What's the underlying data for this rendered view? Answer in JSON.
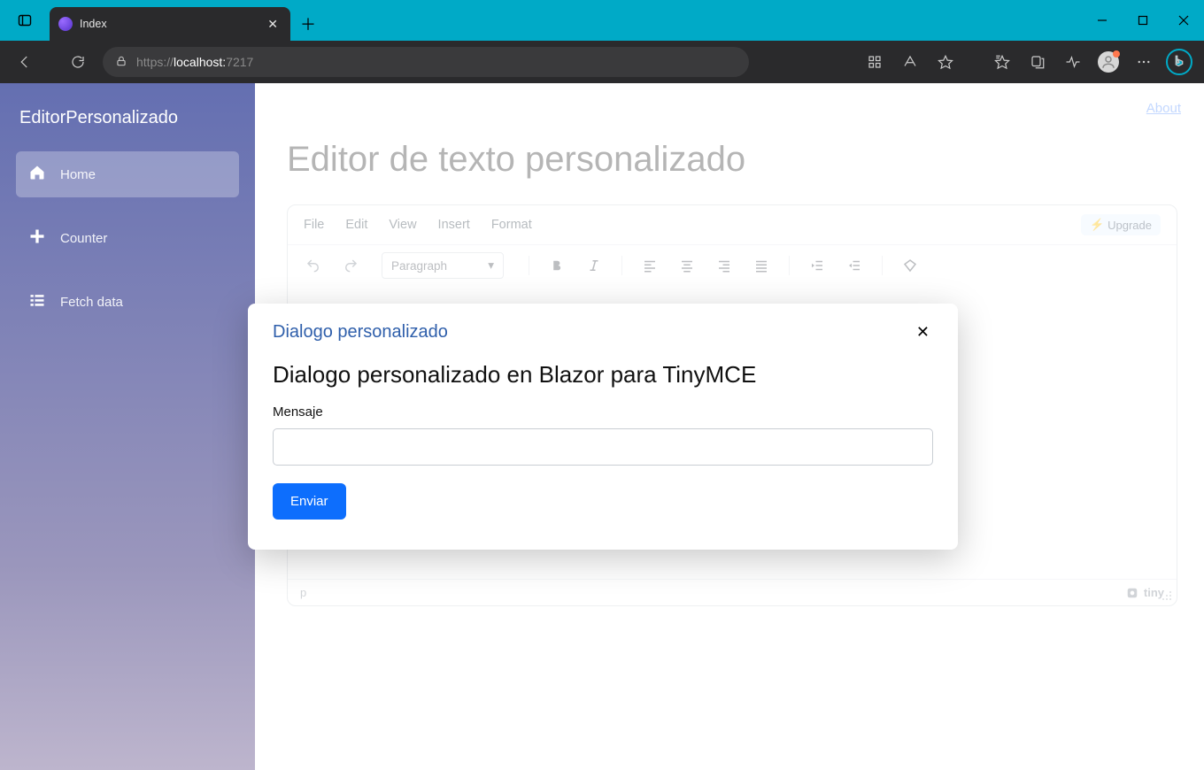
{
  "browser": {
    "tab_title": "Index",
    "url_scheme": "https://",
    "url_host": "localhost:",
    "url_port": "7217"
  },
  "sidebar": {
    "brand": "EditorPersonalizado",
    "items": [
      {
        "label": "Home",
        "icon": "home-icon",
        "active": true
      },
      {
        "label": "Counter",
        "icon": "plus-icon",
        "active": false
      },
      {
        "label": "Fetch data",
        "icon": "list-icon",
        "active": false
      }
    ]
  },
  "topnav": {
    "about": "About"
  },
  "page": {
    "title": "Editor de texto personalizado"
  },
  "editor": {
    "menu": [
      "File",
      "Edit",
      "View",
      "Insert",
      "Format"
    ],
    "upgrade": "Upgrade",
    "paragraph": "Paragraph",
    "status_path": "p",
    "brand": "tiny"
  },
  "dialog": {
    "title": "Dialogo personalizado",
    "heading": "Dialogo personalizado en Blazor para TinyMCE",
    "field_label": "Mensaje",
    "field_value": "",
    "submit": "Enviar"
  }
}
